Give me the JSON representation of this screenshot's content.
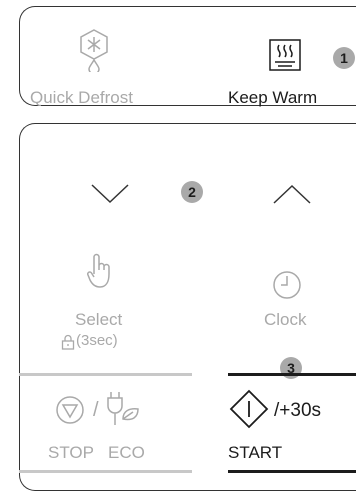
{
  "panel_top": {
    "quick_defrost": {
      "label": "Quick Defrost",
      "icon": "snowflake-drop-icon"
    },
    "keep_warm": {
      "label": "Keep Warm",
      "icon": "warming-plate-icon"
    },
    "badge": "1"
  },
  "panel_bottom": {
    "down_badge": "2",
    "select": {
      "label": "Select",
      "sublabel": "(3sec)",
      "icon": "hand-touch-icon"
    },
    "clock": {
      "label": "Clock",
      "icon": "clock-icon"
    },
    "start_badge": "3",
    "stop_eco": {
      "stop_label": "STOP",
      "eco_label": "ECO",
      "separator": "/"
    },
    "start": {
      "label": "START",
      "plus": "/+30s"
    }
  },
  "colors": {
    "dim": "#a9a9a9",
    "dark": "#1c1c1c",
    "badge": "#a9a9a9"
  }
}
